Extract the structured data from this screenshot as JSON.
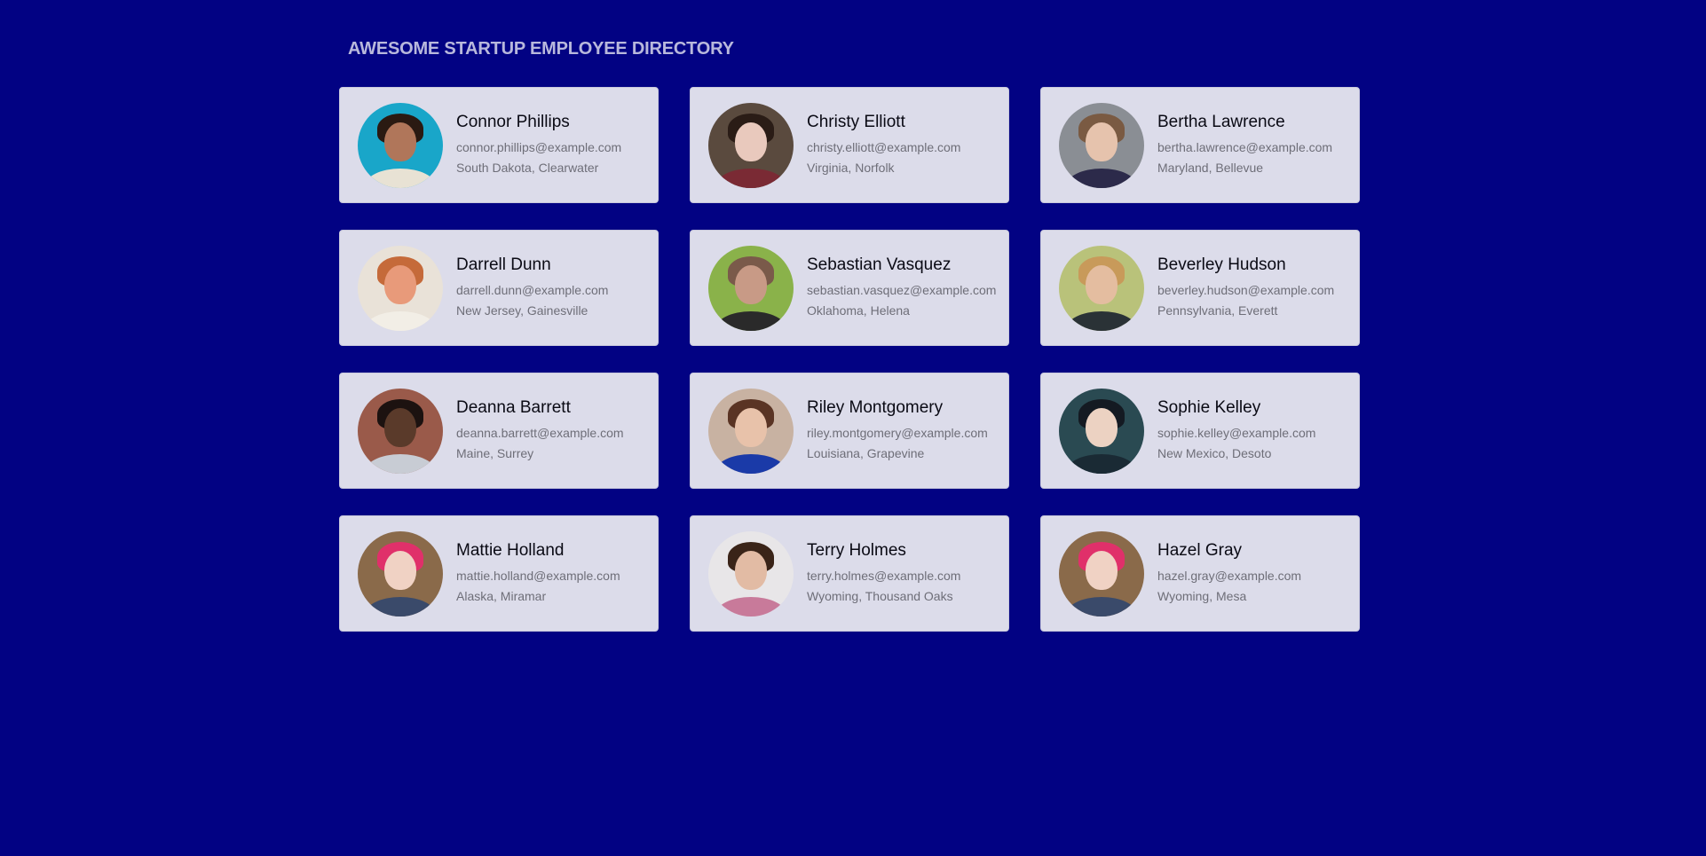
{
  "header": {
    "title": "AWESOME STARTUP EMPLOYEE DIRECTORY"
  },
  "colors": {
    "page_background": "#020283",
    "card_background": "#dcdcea",
    "name_text": "#0a0a14",
    "detail_text": "#6e6e78"
  },
  "employees": [
    {
      "name": "Connor Phillips",
      "email": "connor.phillips@example.com",
      "location": "South Dakota, Clearwater",
      "avatar": {
        "bg": "#19a6c9",
        "skin": "#b0765a",
        "hair": "#2a1a12",
        "shirt": "#e8e2d4"
      }
    },
    {
      "name": "Christy Elliott",
      "email": "christy.elliott@example.com",
      "location": "Virginia, Norfolk",
      "avatar": {
        "bg": "#5a4a3e",
        "skin": "#e9c9bd",
        "hair": "#2a1c16",
        "shirt": "#7a2a34"
      }
    },
    {
      "name": "Bertha Lawrence",
      "email": "bertha.lawrence@example.com",
      "location": "Maryland, Bellevue",
      "avatar": {
        "bg": "#8a8e94",
        "skin": "#e6c3ad",
        "hair": "#7a5a42",
        "shirt": "#2c2a4a"
      }
    },
    {
      "name": "Darrell Dunn",
      "email": "darrell.dunn@example.com",
      "location": "New Jersey, Gainesville",
      "avatar": {
        "bg": "#e9e2d8",
        "skin": "#e89a7a",
        "hair": "#c56a3a",
        "shirt": "#f2eee6"
      }
    },
    {
      "name": "Sebastian Vasquez",
      "email": "sebastian.vasquez@example.com",
      "location": "Oklahoma, Helena",
      "avatar": {
        "bg": "#8ab24a",
        "skin": "#c89a86",
        "hair": "#7a5a4a",
        "shirt": "#2a2a2a"
      }
    },
    {
      "name": "Beverley Hudson",
      "email": "beverley.hudson@example.com",
      "location": "Pennsylvania, Everett",
      "avatar": {
        "bg": "#b9c27a",
        "skin": "#e4bda0",
        "hair": "#c89a5a",
        "shirt": "#2a3236"
      }
    },
    {
      "name": "Deanna Barrett",
      "email": "deanna.barrett@example.com",
      "location": "Maine, Surrey",
      "avatar": {
        "bg": "#9a5a4a",
        "skin": "#5a3a2a",
        "hair": "#1c1210",
        "shirt": "#c8ccd4"
      }
    },
    {
      "name": "Riley Montgomery",
      "email": "riley.montgomery@example.com",
      "location": "Louisiana, Grapevine",
      "avatar": {
        "bg": "#c8b2a2",
        "skin": "#e8c2aa",
        "hair": "#5a3424",
        "shirt": "#1a3aa8"
      }
    },
    {
      "name": "Sophie Kelley",
      "email": "sophie.kelley@example.com",
      "location": "New Mexico, Desoto",
      "avatar": {
        "bg": "#2a4a52",
        "skin": "#ecd2c2",
        "hair": "#141a22",
        "shirt": "#1a2a34"
      }
    },
    {
      "name": "Mattie Holland",
      "email": "mattie.holland@example.com",
      "location": "Alaska, Miramar",
      "avatar": {
        "bg": "#8a6a4a",
        "skin": "#f0d2c4",
        "hair": "#e0306a",
        "shirt": "#3a4a6a"
      }
    },
    {
      "name": "Terry Holmes",
      "email": "terry.holmes@example.com",
      "location": "Wyoming, Thousand Oaks",
      "avatar": {
        "bg": "#e8e6e8",
        "skin": "#e2bba4",
        "hair": "#3a2418",
        "shirt": "#c87a9a"
      }
    },
    {
      "name": "Hazel Gray",
      "email": "hazel.gray@example.com",
      "location": "Wyoming, Mesa",
      "avatar": {
        "bg": "#8a6a4a",
        "skin": "#f0d2c4",
        "hair": "#e0306a",
        "shirt": "#3a4a6a"
      }
    }
  ]
}
